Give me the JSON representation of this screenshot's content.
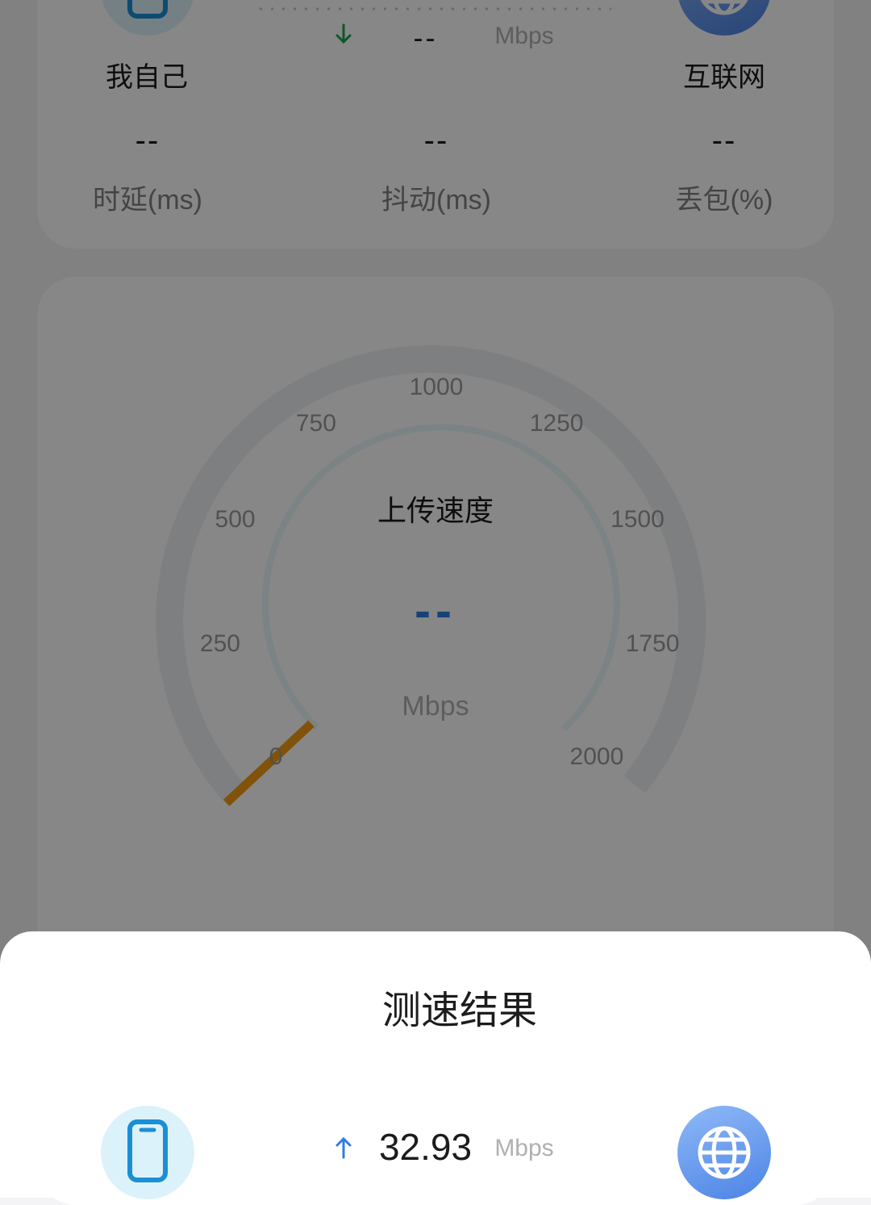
{
  "top": {
    "left_endpoint": "我自己",
    "right_endpoint": "互联网",
    "download_value": "--",
    "download_unit": "Mbps",
    "stats": [
      {
        "value": "--",
        "label": "时延(ms)"
      },
      {
        "value": "--",
        "label": "抖动(ms)"
      },
      {
        "value": "--",
        "label": "丢包(%)"
      }
    ]
  },
  "gauge": {
    "title": "上传速度",
    "value": "--",
    "unit": "Mbps",
    "ticks": [
      "0",
      "250",
      "500",
      "750",
      "1000",
      "1250",
      "1500",
      "1750",
      "2000"
    ],
    "needle_value": 0
  },
  "sheet": {
    "title": "测速结果",
    "upload_value": "32.93",
    "upload_unit": "Mbps"
  },
  "colors": {
    "accent_blue": "#2f7de1",
    "needle": "#f39c12",
    "download_arrow": "#1aa552"
  }
}
